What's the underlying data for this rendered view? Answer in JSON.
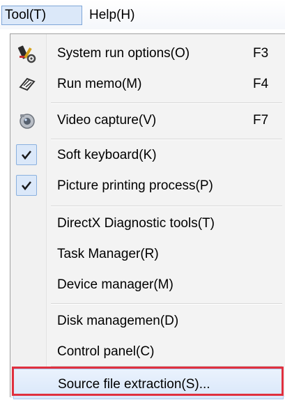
{
  "menubar": {
    "items": [
      {
        "label": "Tool(T)",
        "active": true
      },
      {
        "label": "Help(H)",
        "active": false
      }
    ]
  },
  "menu": {
    "items": [
      {
        "label": "System run options(O)",
        "shortcut": "F3",
        "icon": "settings-tools-icon"
      },
      {
        "label": "Run memo(M)",
        "shortcut": "F4",
        "icon": "memo-pen-icon"
      },
      {
        "label": "Video capture(V)",
        "shortcut": "F7",
        "icon": "camera-icon"
      },
      {
        "label": "Soft keyboard(K)",
        "checked": true
      },
      {
        "label": "Picture printing process(P)",
        "checked": true
      },
      {
        "label": "DirectX Diagnostic tools(T)"
      },
      {
        "label": "Task Manager(R)"
      },
      {
        "label": "Device manager(M)"
      },
      {
        "label": "Disk managemen(D)"
      },
      {
        "label": "Control panel(C)"
      },
      {
        "label": "Source file extraction(S)...",
        "highlighted": true
      }
    ]
  },
  "colors": {
    "highlight_outline": "#e0303e",
    "menu_background": "#f3f3f3",
    "check_background": "#dbe8f9"
  }
}
